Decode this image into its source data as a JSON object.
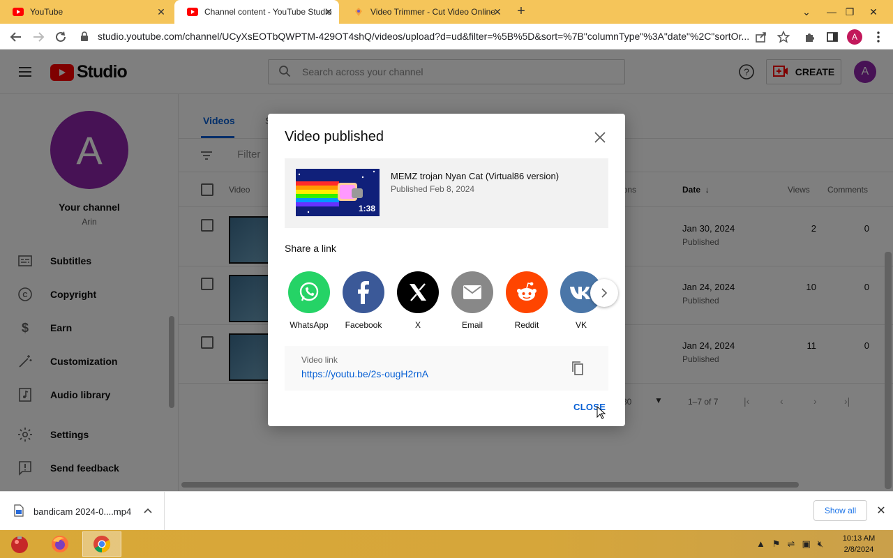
{
  "browser": {
    "tabs": [
      {
        "title": "YouTube"
      },
      {
        "title": "Channel content - YouTube Studio"
      },
      {
        "title": "Video Trimmer - Cut Video Online"
      }
    ],
    "url": "studio.youtube.com/channel/UCyXsEOTbQWPTM-429OT4shQ/videos/upload?d=ud&filter=%5B%5D&sort=%7B\"columnType\"%3A\"date\"%2C\"sortOr...",
    "profile_initial": "A"
  },
  "studio": {
    "logo_text": "Studio",
    "search_placeholder": "Search across your channel",
    "create_label": "CREATE",
    "avatar_initial": "A"
  },
  "sidebar": {
    "avatar_initial": "A",
    "channel_title": "Your channel",
    "channel_name": "Arin",
    "items": [
      {
        "label": "Subtitles",
        "icon": "subtitles-icon"
      },
      {
        "label": "Copyright",
        "icon": "copyright-icon"
      },
      {
        "label": "Earn",
        "icon": "dollar-icon"
      },
      {
        "label": "Customization",
        "icon": "magic-wand-icon"
      },
      {
        "label": "Audio library",
        "icon": "audio-library-icon"
      },
      {
        "label": "Settings",
        "icon": "gear-icon"
      },
      {
        "label": "Send feedback",
        "icon": "feedback-icon"
      }
    ]
  },
  "content": {
    "tab_videos": "Videos",
    "tab_second": "S",
    "filter_label": "Filter",
    "columns": {
      "video": "Video",
      "restrictions": "ions",
      "date": "Date",
      "views": "Views",
      "comments": "Comments"
    },
    "rows": [
      {
        "date": "Jan 30, 2024",
        "status": "Published",
        "views": "2",
        "comments": "0"
      },
      {
        "date": "Jan 24, 2024",
        "status": "Published",
        "views": "10",
        "comments": "0"
      },
      {
        "date": "Jan 24, 2024",
        "status": "Published",
        "views": "11",
        "comments": "0"
      }
    ],
    "pager": {
      "rows_per_page": "30",
      "range": "1–7 of 7"
    }
  },
  "dialog": {
    "title": "Video published",
    "video_title": "MEMZ trojan Nyan Cat (Virtual86 version)",
    "published": "Published Feb 8, 2024",
    "duration": "1:38",
    "share_heading": "Share a link",
    "share_targets": [
      {
        "name": "WhatsApp",
        "color": "#25d366"
      },
      {
        "name": "Facebook",
        "color": "#3b5998"
      },
      {
        "name": "X",
        "color": "#000000"
      },
      {
        "name": "Email",
        "color": "#888888"
      },
      {
        "name": "Reddit",
        "color": "#ff4500"
      },
      {
        "name": "VK",
        "color": "#4a76a8"
      }
    ],
    "link_label": "Video link",
    "link_url": "https://youtu.be/2s-ougH2rnA",
    "close_label": "CLOSE"
  },
  "downloads": {
    "file": "bandicam 2024-0....mp4",
    "show_all": "Show all"
  },
  "taskbar": {
    "time": "10:13 AM",
    "date": "2/8/2024"
  },
  "colors": {
    "accent": "#065fd4",
    "youtube_red": "#ff0000",
    "tab_strip": "#f5c55a"
  }
}
